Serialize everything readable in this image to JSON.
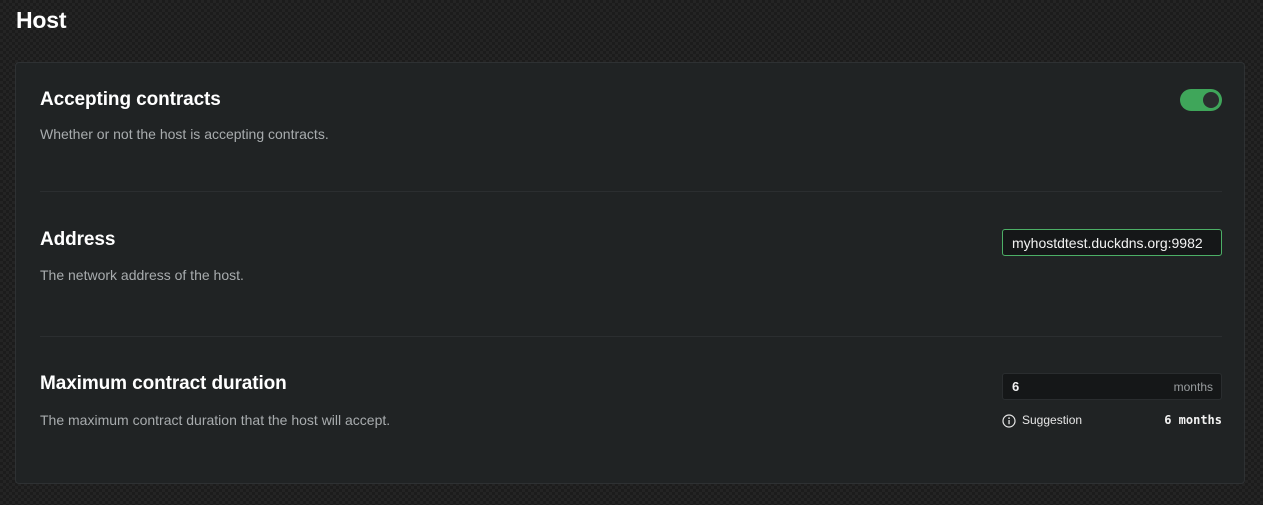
{
  "page": {
    "title": "Host"
  },
  "settings": {
    "accepting_contracts": {
      "title": "Accepting contracts",
      "description": "Whether or not the host is accepting contracts.",
      "enabled": true
    },
    "address": {
      "title": "Address",
      "description": "The network address of the host.",
      "value": "myhostdtest.duckdns.org:9982"
    },
    "max_duration": {
      "title": "Maximum contract duration",
      "description": "The maximum contract duration that the host will accept.",
      "value": "6",
      "unit": "months",
      "suggestion_label": "Suggestion",
      "suggestion_value": "6 months"
    }
  },
  "colors": {
    "accent": "#3fa65a",
    "panel": "#202324",
    "background": "#1c1c1c"
  },
  "icons": {
    "suggestion": "info-circle-icon"
  }
}
